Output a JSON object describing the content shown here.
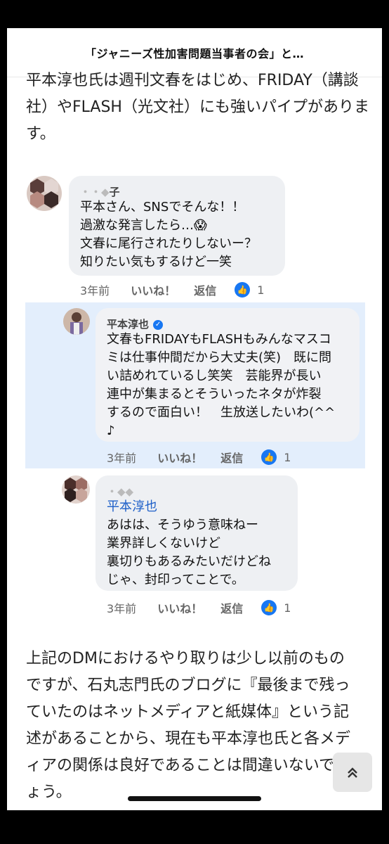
{
  "header": {
    "title": "「ジャニーズ性加害問題当事者の会」と…"
  },
  "article": {
    "intro": "平本淳也氏は週刊文春をはじめ、FRIDAY（講談社）やFLASH（光文社）にも強いパイプがあります。",
    "outro": "上記のDMにおけるやり取りは少し以前のものですが、石丸志門氏のブログに『最後まで残っていたのはネットメディアと紙媒体』という記述があることから、現在も平本淳也氏と各メディアの関係は良好であることは間違いないでしょう。"
  },
  "comments": [
    {
      "name": "子",
      "lines": [
        "平本さん、SNSでそんな！！",
        "過激な発言したら…😱",
        "文春に尾行されたりしないー？",
        "知りたい気もするけど一笑"
      ],
      "time": "3年前",
      "like": "いいね！",
      "reply": "返信",
      "likes": "1"
    },
    {
      "name": "平本淳也",
      "lines": [
        "文春もFRIDAYもFLASHもみんなマスコ",
        "ミは仕事仲間だから大丈夫(笑)　既に問",
        "い詰めれているし笑笑　芸能界が長い",
        "連中が集まるとそういったネタが炸裂",
        "するので面白い！　生放送したいわ(^^",
        "♪"
      ],
      "time": "3年前",
      "like": "いいね！",
      "reply": "返信",
      "likes": "1"
    },
    {
      "mention": "平本淳也",
      "lines": [
        "あはは、そうゆう意味ねー",
        "業界詳しくないけど",
        "裏切りもあるみたいだけどね",
        "じゃ、封印ってことで。"
      ],
      "time": "3年前",
      "like": "いいね！",
      "reply": "返信",
      "likes": "1"
    }
  ],
  "icons": {
    "scroll_top": "chevrons-up-icon",
    "like": "thumbs-up-icon",
    "verified": "verified-badge-icon"
  },
  "colors": {
    "like_blue": "#1877f2",
    "highlight": "#e3eefc",
    "mention": "#1d5fc8"
  }
}
